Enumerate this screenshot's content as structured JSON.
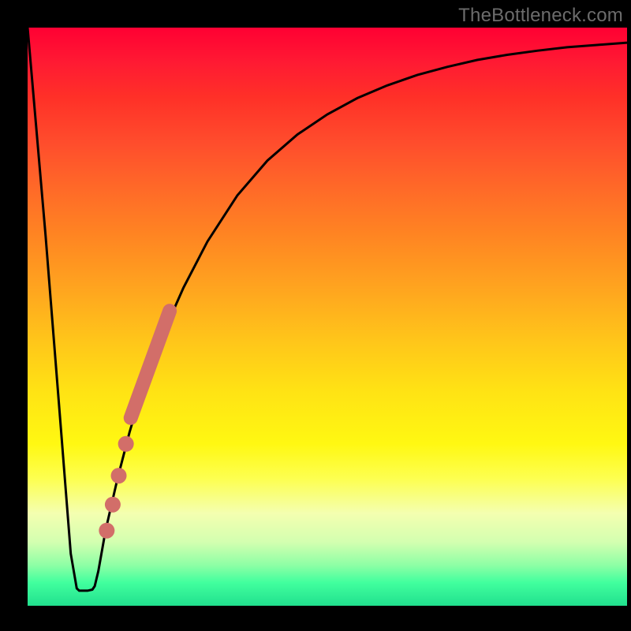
{
  "watermark": "TheBottleneck.com",
  "chart_data": {
    "type": "line",
    "title": "",
    "xlabel": "",
    "ylabel": "",
    "xlim": [
      0,
      1
    ],
    "ylim": [
      0,
      1
    ],
    "background": "rainbow-vertical-gradient",
    "series": [
      {
        "name": "curve",
        "color": "#000000",
        "stroke_width": 3,
        "x": [
          0.0,
          0.03,
          0.056,
          0.072,
          0.082,
          0.086,
          0.094,
          0.1,
          0.108,
          0.112,
          0.118,
          0.13,
          0.15,
          0.17,
          0.19,
          0.21,
          0.23,
          0.26,
          0.3,
          0.35,
          0.4,
          0.45,
          0.5,
          0.55,
          0.6,
          0.65,
          0.7,
          0.75,
          0.8,
          0.85,
          0.9,
          0.95,
          1.0
        ],
        "y": [
          1.0,
          0.64,
          0.3,
          0.09,
          0.03,
          0.026,
          0.026,
          0.026,
          0.028,
          0.034,
          0.06,
          0.13,
          0.22,
          0.3,
          0.37,
          0.43,
          0.48,
          0.55,
          0.63,
          0.71,
          0.77,
          0.815,
          0.85,
          0.878,
          0.9,
          0.918,
          0.932,
          0.944,
          0.953,
          0.96,
          0.966,
          0.97,
          0.974
        ]
      },
      {
        "name": "highlight-segment",
        "color": "#d26e69",
        "style": "thick-stroke",
        "stroke_width": 18,
        "x": [
          0.172,
          0.237
        ],
        "y": [
          0.325,
          0.51
        ]
      },
      {
        "name": "highlight-dots",
        "color": "#d26e69",
        "style": "dots",
        "radius": 10,
        "points": [
          {
            "x": 0.164,
            "y": 0.28
          },
          {
            "x": 0.152,
            "y": 0.225
          },
          {
            "x": 0.142,
            "y": 0.175
          },
          {
            "x": 0.132,
            "y": 0.13
          }
        ]
      }
    ]
  },
  "colors": {
    "frame": "#000000",
    "curve": "#000000",
    "highlight": "#d26e69",
    "watermark": "#6c6c6c"
  }
}
